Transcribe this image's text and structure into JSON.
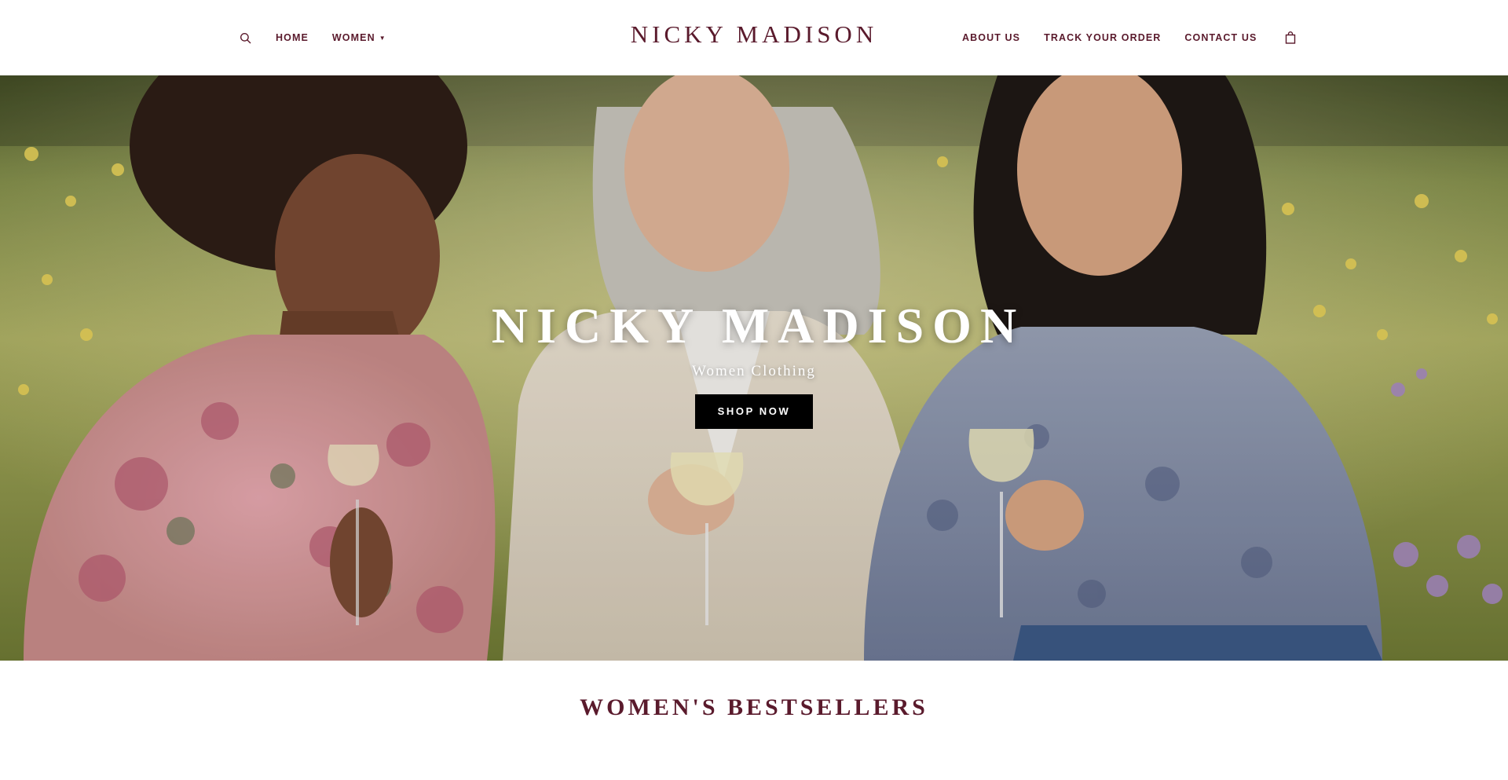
{
  "header": {
    "brand": "NICKY MADISON",
    "search_icon": "search-icon",
    "cart_icon": "shopping-bag-icon",
    "nav_left": [
      {
        "label": "HOME"
      },
      {
        "label": "WOMEN",
        "has_dropdown": true,
        "dropdown_icon": "caret-down-icon"
      }
    ],
    "nav_right": [
      {
        "label": "ABOUT US"
      },
      {
        "label": "TRACK YOUR ORDER"
      },
      {
        "label": "CONTACT US"
      }
    ],
    "caret_glyph": "▼"
  },
  "hero": {
    "title": "NICKY MADISON",
    "subtitle": "Women Clothing",
    "cta_label": "SHOP NOW"
  },
  "bestsellers": {
    "title": "WOMEN'S BESTSELLERS"
  },
  "colors": {
    "brand": "#5a1a2c",
    "cta_bg": "#000000",
    "cta_text": "#ffffff",
    "hero_text": "#ffffff"
  }
}
